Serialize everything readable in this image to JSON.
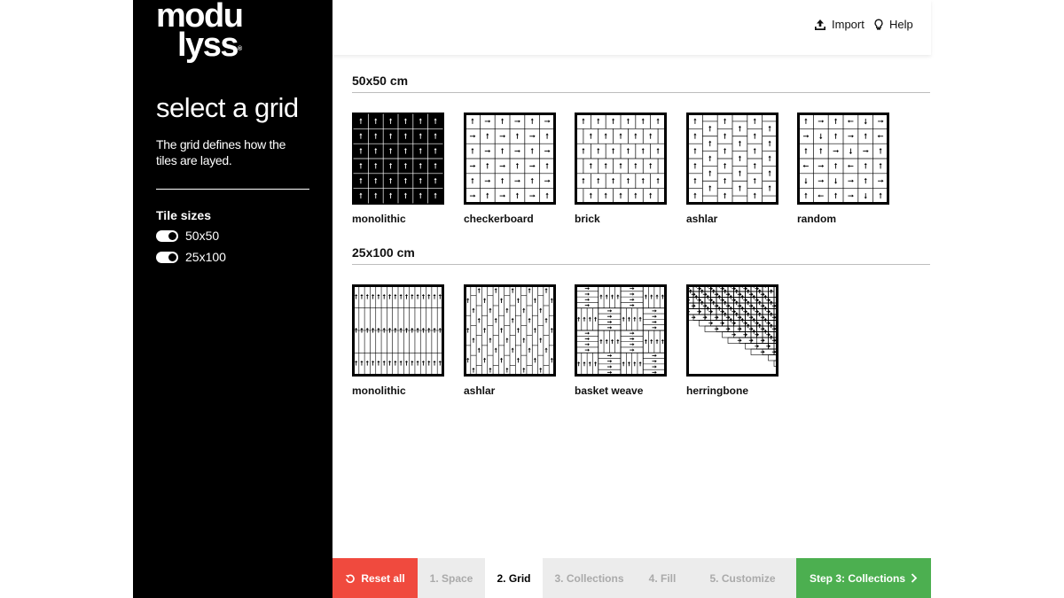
{
  "brand": {
    "line1": "modu",
    "line2": "lyss",
    "registered": "®"
  },
  "sidebar": {
    "title": "select a grid",
    "description": "The grid defines how the tiles are layed.",
    "tile_sizes_title": "Tile sizes",
    "tile_sizes": [
      {
        "label": "50x50",
        "enabled": true
      },
      {
        "label": "25x100",
        "enabled": true
      }
    ]
  },
  "topbar": {
    "import_label": "Import",
    "help_label": "Help"
  },
  "sections": [
    {
      "title": "50x50 cm",
      "grids": [
        {
          "label": "monolithic",
          "pattern": "monolithic-50",
          "selected": true
        },
        {
          "label": "checkerboard",
          "pattern": "checkerboard-50"
        },
        {
          "label": "brick",
          "pattern": "brick-50"
        },
        {
          "label": "ashlar",
          "pattern": "ashlar-50"
        },
        {
          "label": "random",
          "pattern": "random-50"
        }
      ]
    },
    {
      "title": "25x100 cm",
      "grids": [
        {
          "label": "monolithic",
          "pattern": "monolithic-25x100"
        },
        {
          "label": "ashlar",
          "pattern": "ashlar-25x100"
        },
        {
          "label": "basket weave",
          "pattern": "basket-weave"
        },
        {
          "label": "herringbone",
          "pattern": "herringbone"
        }
      ]
    }
  ],
  "steps": {
    "reset_label": "Reset all",
    "items": [
      "1. Space",
      "2. Grid",
      "3. Collections",
      "4. Fill",
      "5. Customize"
    ],
    "active_index": 1,
    "next_label": "Step 3: Collections"
  },
  "colors": {
    "reset": "#f04a3e",
    "next": "#4caf50",
    "sidebar": "#000000",
    "muted_step": "#ececec"
  },
  "icons": [
    "upload-icon",
    "lightbulb-icon",
    "reset-icon",
    "chevron-right-icon"
  ]
}
